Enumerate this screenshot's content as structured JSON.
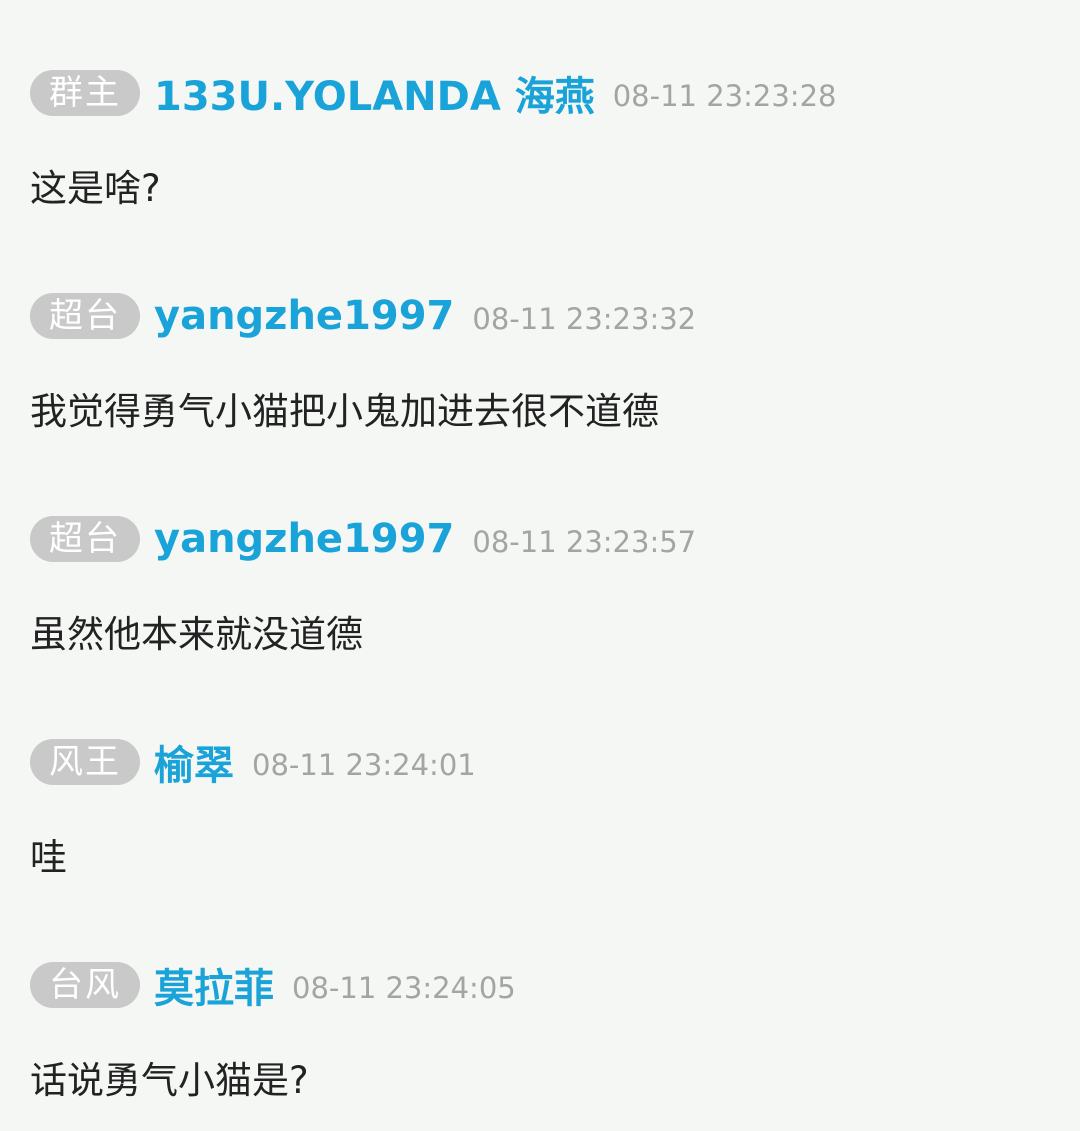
{
  "messages": [
    {
      "badge": "群主",
      "username": "133U.YOLANDA 海燕",
      "timestamp": "08-11 23:23:28",
      "text": "这是啥?"
    },
    {
      "badge": "超台",
      "username": "yangzhe1997",
      "timestamp": "08-11 23:23:32",
      "text": "我觉得勇气小猫把小鬼加进去很不道德"
    },
    {
      "badge": "超台",
      "username": "yangzhe1997",
      "timestamp": "08-11 23:23:57",
      "text": "虽然他本来就没道德"
    },
    {
      "badge": "风王",
      "username": "榆翠",
      "timestamp": "08-11 23:24:01",
      "text": "哇"
    },
    {
      "badge": "台风",
      "username": "莫拉菲",
      "timestamp": "08-11 23:24:05",
      "text": "话说勇气小猫是?"
    }
  ],
  "colors": {
    "background": "#f4f7f4",
    "badge_background": "#c8c9c8",
    "username": "#1aa3d9",
    "timestamp": "#a3a5a3",
    "message_text": "#222222"
  }
}
